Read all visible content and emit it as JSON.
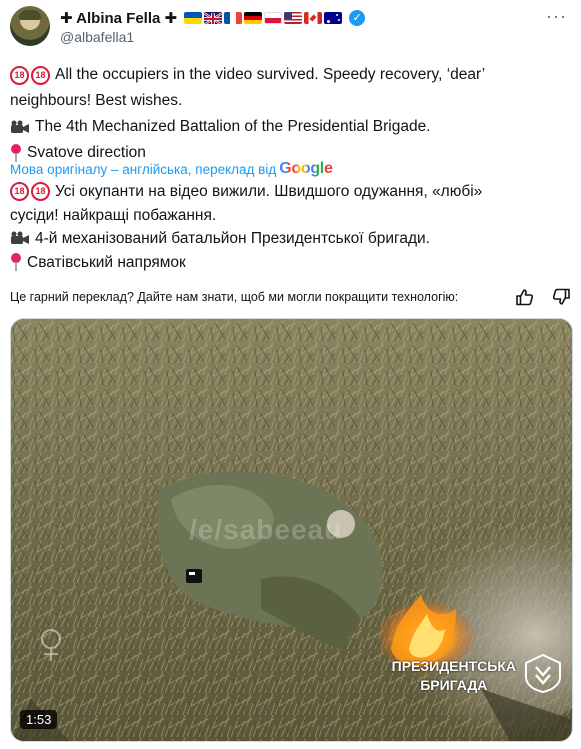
{
  "author": {
    "display_name": "✚ Albina Fella ✚",
    "handle": "@albafella1",
    "flags": [
      "ua",
      "gb",
      "fr",
      "de",
      "pl",
      "us",
      "ca",
      "au"
    ],
    "verified": true
  },
  "tweet": {
    "original_lines": [
      {
        "prefix": "18-badge",
        "text": "All the occupiers in the video survived. Speedy recovery, ‘dear’"
      },
      {
        "prefix": "",
        "text": "neighbours! Best wishes."
      },
      {
        "prefix": "camera-icon",
        "text": "The 4th Mechanized Battalion of the Presidential Brigade."
      },
      {
        "prefix": "pin-icon",
        "text": "Svatove direction"
      }
    ],
    "translation_notice": "Мова оригіналу – англійська, переклад від",
    "translation_provider": "Google",
    "translated_lines": [
      {
        "prefix": "18-badge",
        "text": "Усі окупанти на відео вижили. Швидшого одужання, «любі»"
      },
      {
        "prefix": "",
        "text": "сусіди! найкращі побажання."
      },
      {
        "prefix": "camera-icon",
        "text": "4-й механізований батальйон Президентської бригади."
      },
      {
        "prefix": "pin-icon",
        "text": "Сватівський напрямок"
      }
    ]
  },
  "feedback": {
    "prompt": "Це гарний переклад? Дайте нам знати, щоб ми могли покращити технологію:"
  },
  "media": {
    "duration": "1:53",
    "overlay_line1": "ПРЕЗИДЕНТСЬКА",
    "overlay_line2": "БРИГАДА",
    "watermark": "/e/sabeeau"
  },
  "colors": {
    "link": "#1d9bf0",
    "text": "#0f1419",
    "muted": "#536471",
    "verified": "#1d9bf0"
  }
}
